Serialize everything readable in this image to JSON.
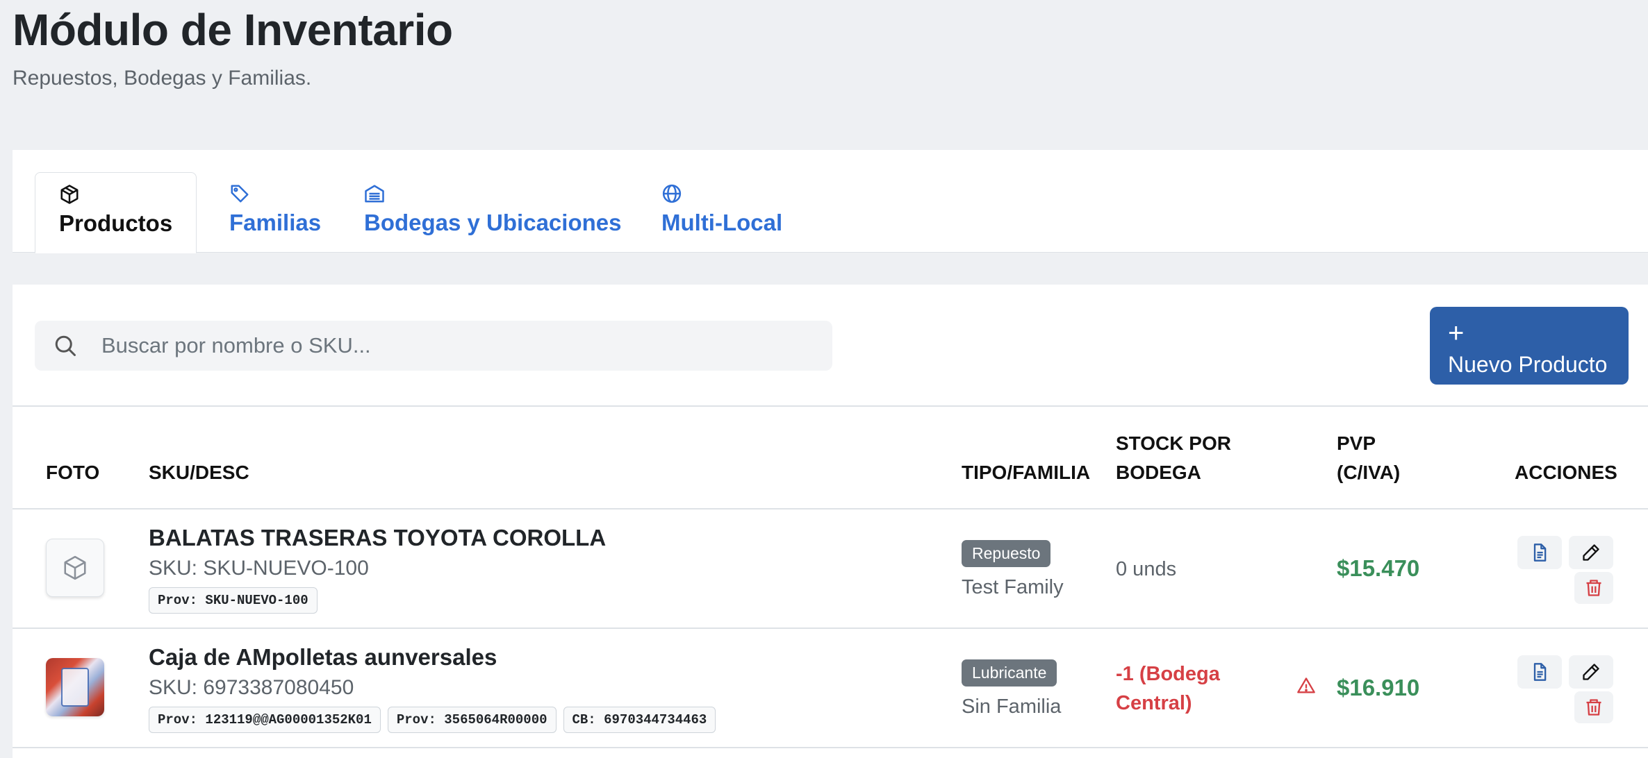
{
  "header": {
    "title": "Módulo de Inventario",
    "subtitle": "Repuestos, Bodegas y Familias."
  },
  "tabs": [
    {
      "label": "Productos",
      "icon": "box-icon",
      "active": true
    },
    {
      "label": "Familias",
      "icon": "tag-icon",
      "active": false
    },
    {
      "label": "Bodegas y Ubicaciones",
      "icon": "warehouse-icon",
      "active": false
    },
    {
      "label": "Multi-Local",
      "icon": "globe-icon",
      "active": false
    }
  ],
  "toolbar": {
    "search_placeholder": "Buscar por nombre o SKU...",
    "search_value": "",
    "new_button_icon": "+",
    "new_button_label": "Nuevo Producto"
  },
  "table": {
    "columns": {
      "foto": "FOTO",
      "sku_desc": "SKU/DESC",
      "tipo_familia": "TIPO/FAMILIA",
      "stock_line1": "STOCK POR",
      "stock_line2": "BODEGA",
      "pvp_line1": "PVP",
      "pvp_line2": "(C/IVA)",
      "acciones": "ACCIONES"
    },
    "rows": [
      {
        "name": "BALATAS TRASERAS TOYOTA COROLLA",
        "sku": "SKU: SKU-NUEVO-100",
        "chips": [
          "Prov: SKU-NUEVO-100"
        ],
        "type": "Repuesto",
        "family": "Test Family",
        "stock": "0 unds",
        "price": "$15.470",
        "photo": "placeholder"
      },
      {
        "name": "Caja de AMpolletas aunversales",
        "sku": "SKU: 6973387080450",
        "chips": [
          "Prov: 123119@@AG00001352K01",
          "Prov: 3565064R00000",
          "CB: 6970344734463"
        ],
        "type": "Lubricante",
        "family": "Sin Familia",
        "stock_line1": "-1 (Bodega",
        "stock_line2": "Central)",
        "price": "$16.910",
        "photo": "image"
      }
    ]
  },
  "colors": {
    "accent": "#2d5fa8",
    "link": "#2f6fd6",
    "price": "#3a8f5a",
    "danger": "#d64045",
    "badge": "#6c757d"
  }
}
